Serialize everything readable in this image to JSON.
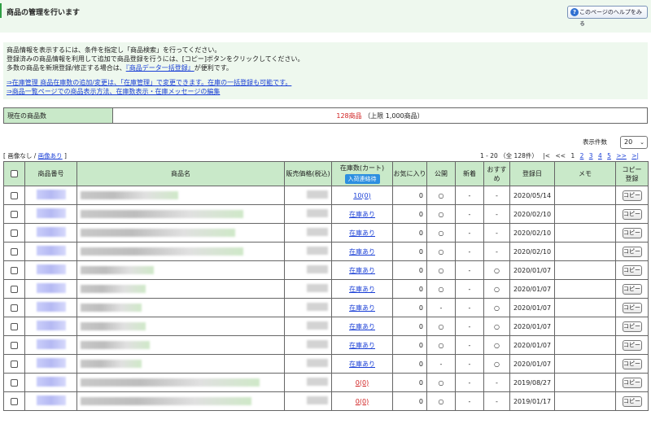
{
  "header": {
    "title": "商品の管理を行います",
    "help_label": "このページのヘルプをみる"
  },
  "info": {
    "line1": "商品情報を表示するには、条件を指定し「商品検索」を行ってください。",
    "line2": "登録済みの商品情報を利用して追加で商品登録を行うには、[コピー]ボタンをクリックしてください。",
    "line3_prefix": "多数の商品を新規登録/修正する場合は、",
    "line3_link": "『商品データ一括登録』",
    "line3_suffix": "が便利です。",
    "link1": "⇒在庫管理 商品在庫数の追加/変更は、「在庫管理」で変更できます。在庫の一括登録も可能です。",
    "link2": "⇒商品一覧ページでの商品表示方法、在庫数表示・在庫メッセージの編集"
  },
  "count": {
    "label": "現在の商品数",
    "value": "128商品",
    "limit": "（上限 1,000商品）"
  },
  "display": {
    "label": "表示件数",
    "selected": "20"
  },
  "image_toggle": {
    "open": "[",
    "none": "画像なし",
    "sep": "/",
    "with": "画像あり",
    "close": "]"
  },
  "pager": {
    "range": "1 - 20 （全 128件）",
    "first": "|<",
    "prev": "<<",
    "pages": [
      "1",
      "2",
      "3",
      "4",
      "5"
    ],
    "next": ">>",
    "last": ">|"
  },
  "table": {
    "headers": {
      "id": "商品番号",
      "name": "商品名",
      "price": "販売価格(税込)",
      "stock": "在庫数(カート)",
      "arrival": "入荷連絡待",
      "fav": "お気に入り",
      "public": "公開",
      "new": "新着",
      "recommend": "おすすめ",
      "date": "登録日",
      "memo": "メモ",
      "copy_line1": "コピー",
      "copy_line2": "登録"
    },
    "copy_label": "コピー",
    "rows": [
      {
        "stock": "10(0)",
        "stock_red": false,
        "fav": "0",
        "public": "○",
        "new": "-",
        "rec": "-",
        "date": "2020/05/14",
        "name_w": 120
      },
      {
        "stock": "在庫あり",
        "stock_red": false,
        "fav": "0",
        "public": "○",
        "new": "-",
        "rec": "-",
        "date": "2020/02/10",
        "name_w": 200
      },
      {
        "stock": "在庫あり",
        "stock_red": false,
        "fav": "0",
        "public": "○",
        "new": "-",
        "rec": "-",
        "date": "2020/02/10",
        "name_w": 190
      },
      {
        "stock": "在庫あり",
        "stock_red": false,
        "fav": "0",
        "public": "○",
        "new": "-",
        "rec": "-",
        "date": "2020/02/10",
        "name_w": 200
      },
      {
        "stock": "在庫あり",
        "stock_red": false,
        "fav": "0",
        "public": "○",
        "new": "-",
        "rec": "○",
        "date": "2020/01/07",
        "name_w": 90
      },
      {
        "stock": "在庫あり",
        "stock_red": false,
        "fav": "0",
        "public": "○",
        "new": "-",
        "rec": "○",
        "date": "2020/01/07",
        "name_w": 80
      },
      {
        "stock": "在庫あり",
        "stock_red": false,
        "fav": "0",
        "public": "-",
        "new": "-",
        "rec": "○",
        "date": "2020/01/07",
        "name_w": 75
      },
      {
        "stock": "在庫あり",
        "stock_red": false,
        "fav": "0",
        "public": "○",
        "new": "-",
        "rec": "○",
        "date": "2020/01/07",
        "name_w": 80
      },
      {
        "stock": "在庫あり",
        "stock_red": false,
        "fav": "0",
        "public": "○",
        "new": "-",
        "rec": "○",
        "date": "2020/01/07",
        "name_w": 85
      },
      {
        "stock": "在庫あり",
        "stock_red": false,
        "fav": "0",
        "public": "-",
        "new": "-",
        "rec": "○",
        "date": "2020/01/07",
        "name_w": 75
      },
      {
        "stock": "0(0)",
        "stock_red": true,
        "fav": "0",
        "public": "○",
        "new": "-",
        "rec": "-",
        "date": "2019/08/27",
        "name_w": 220
      },
      {
        "stock": "0(0)",
        "stock_red": true,
        "fav": "0",
        "public": "○",
        "new": "-",
        "rec": "-",
        "date": "2019/01/17",
        "name_w": 210
      }
    ]
  }
}
